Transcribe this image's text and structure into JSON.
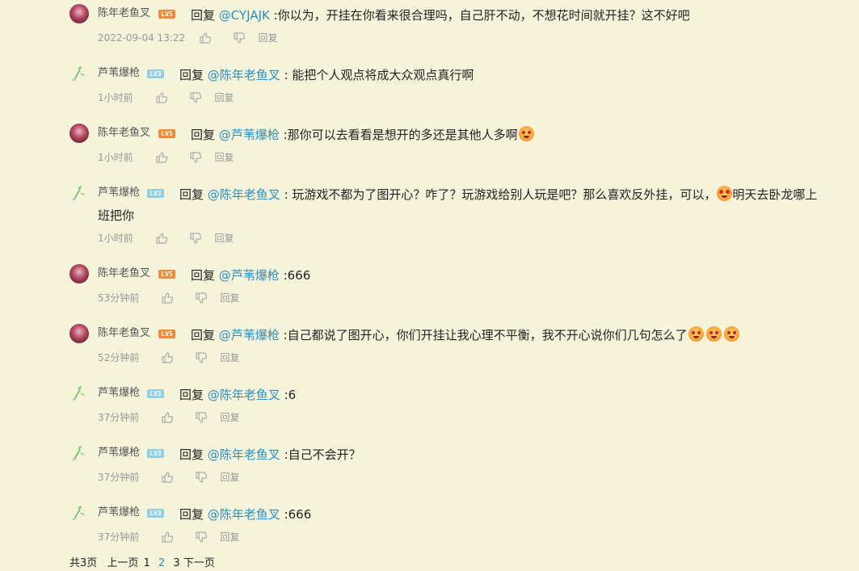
{
  "replies": [
    {
      "user": "陈年老鱼叉",
      "level": "LV5",
      "avatar": "red",
      "prefix": "回复 ",
      "at": "@CYJAJK",
      "text": " :你以为，开挂在你看来很合理吗，自己肝不动，不想花时间就开挂？这不好吧",
      "emoji": 0,
      "time": "2022-09-04 13:22",
      "reply_label": "回复"
    },
    {
      "user": "芦苇爆枪",
      "level": "LV3",
      "avatar": "green",
      "prefix": "回复 ",
      "at": "@陈年老鱼叉",
      "text": " : 能把个人观点将成大众观点真行啊",
      "emoji": 0,
      "time": "1小时前",
      "reply_label": "回复"
    },
    {
      "user": "陈年老鱼叉",
      "level": "LV5",
      "avatar": "red",
      "prefix": "回复 ",
      "at": "@芦苇爆枪",
      "text": " :那你可以去看看是想开的多还是其他人多啊",
      "emoji": 1,
      "time": "1小时前",
      "reply_label": "回复"
    },
    {
      "user": "芦苇爆枪",
      "level": "LV3",
      "avatar": "green",
      "prefix": "回复 ",
      "at": "@陈年老鱼叉",
      "text": " : 玩游戏不都为了图开心？咋了？玩游戏给别人玩是吧？那么喜欢反外挂，可以，",
      "text2": "明天去卧龙哪上",
      "line2": "班把你",
      "time": "1小时前",
      "reply_label": "回复"
    },
    {
      "user": "陈年老鱼叉",
      "level": "LV5",
      "avatar": "red",
      "prefix": "回复 ",
      "at": "@芦苇爆枪",
      "text": " :666",
      "emoji": 0,
      "time": "53分钟前",
      "reply_label": "回复"
    },
    {
      "user": "陈年老鱼叉",
      "level": "LV5",
      "avatar": "red",
      "prefix": "回复 ",
      "at": "@芦苇爆枪",
      "text": " :自己都说了图开心，你们开挂让我心理不平衡，我不开心说你们几句怎么了",
      "emoji": 3,
      "time": "52分钟前",
      "reply_label": "回复"
    },
    {
      "user": "芦苇爆枪",
      "level": "LV3",
      "avatar": "green",
      "prefix": "回复 ",
      "at": "@陈年老鱼叉",
      "text": " :6",
      "emoji": 0,
      "time": "37分钟前",
      "reply_label": "回复"
    },
    {
      "user": "芦苇爆枪",
      "level": "LV3",
      "avatar": "green",
      "prefix": "回复 ",
      "at": "@陈年老鱼叉",
      "text": " :自己不会开？",
      "emoji": 0,
      "time": "37分钟前",
      "reply_label": "回复"
    },
    {
      "user": "芦苇爆枪",
      "level": "LV3",
      "avatar": "green",
      "prefix": "回复 ",
      "at": "@陈年老鱼叉",
      "text": " :666",
      "emoji": 0,
      "time": "37分钟前",
      "reply_label": "回复"
    }
  ],
  "pager": {
    "total": "共3页",
    "prev": "上一页",
    "p1": "1",
    "p2": "2",
    "p3": "3",
    "next": "下一页"
  },
  "colors": {
    "background": "#f5f3da",
    "mention": "#2a8fc2",
    "lv5": "#f08a3c",
    "lv3": "#8fd0e6"
  }
}
